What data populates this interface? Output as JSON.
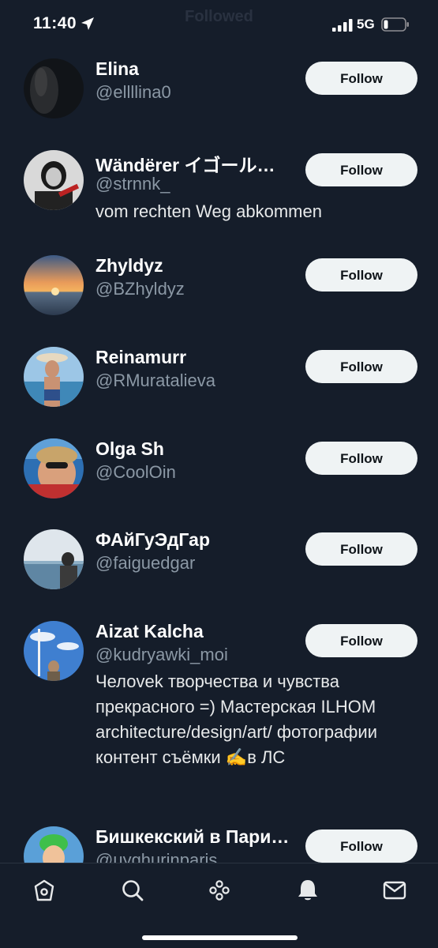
{
  "status_bar": {
    "time": "11:40",
    "network": "5G",
    "ghost_title": "Followed"
  },
  "follow_label": "Follow",
  "users": [
    {
      "name": "Elina",
      "handle": "@ellllina0",
      "bio": ""
    },
    {
      "name": "Wändërer イゴール…",
      "handle": "@strnnk_",
      "bio": "vom rechten Weg abkommen"
    },
    {
      "name": "Zhyldyz",
      "handle": "@BZhyldyz",
      "bio": ""
    },
    {
      "name": "Reinamurr",
      "handle": "@RMuratalieva",
      "bio": ""
    },
    {
      "name": "Olga Sh",
      "handle": "@CoolOin",
      "bio": ""
    },
    {
      "name": "ФАйГуЭдГар",
      "handle": "@faiguedgar",
      "bio": ""
    },
    {
      "name": "Aizat Kalcha",
      "handle": "@kudryawki_moi",
      "bio": "Челоvek творчества и чувства прекрасного =) Мастерская ILHOM architecture/design/art/ фотографии контент съёмки ✍️в ЛС"
    },
    {
      "name": "Бишкекский в Пари…",
      "handle": "@uyghurinparis",
      "bio": ""
    }
  ],
  "tabs": [
    {
      "icon": "home-icon"
    },
    {
      "icon": "search-icon"
    },
    {
      "icon": "spaces-icon"
    },
    {
      "icon": "notifications-icon",
      "active": true
    },
    {
      "icon": "messages-icon"
    }
  ],
  "colors": {
    "background": "#151d2a",
    "button_bg": "#eff3f4",
    "secondary_text": "#8b98a5"
  }
}
